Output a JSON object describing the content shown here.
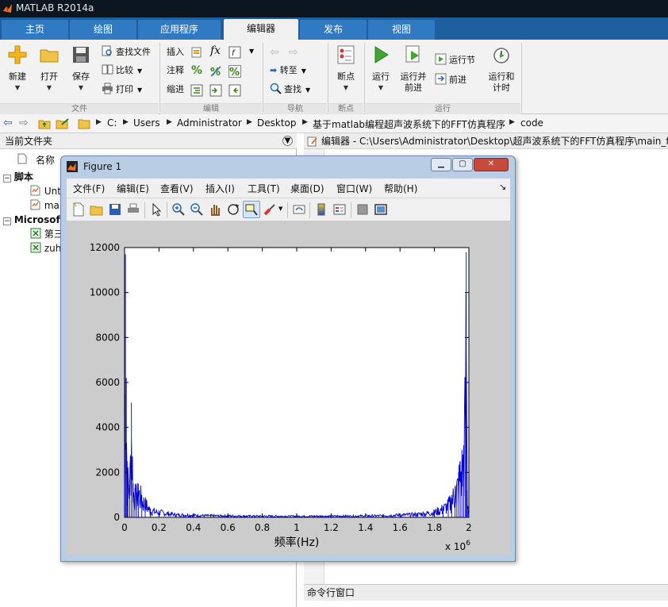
{
  "app": {
    "title": "MATLAB R2014a"
  },
  "tabs": [
    {
      "label": "主页",
      "active": false
    },
    {
      "label": "绘图",
      "active": false
    },
    {
      "label": "应用程序",
      "active": false
    },
    {
      "label": "编辑器",
      "active": true
    },
    {
      "label": "发布",
      "active": false
    },
    {
      "label": "视图",
      "active": false
    }
  ],
  "ribbon": {
    "file": {
      "new_label": "新建",
      "open_label": "打开",
      "save_label": "保存",
      "find_file_label": "查找文件",
      "compare_label": "比较",
      "print_label": "打印",
      "group_label": "文件"
    },
    "edit": {
      "insert_label": "插入",
      "fx_label": "fx",
      "comment_label": "注释",
      "comment_symbol": "%",
      "indent_label": "缩进",
      "group_label": "编辑"
    },
    "nav": {
      "goto_label": "转至",
      "find_label": "查找",
      "group_label": "导航"
    },
    "breakpoints": {
      "label": "断点",
      "group_label": "断点"
    },
    "run": {
      "run_label": "运行",
      "run_advance_label": "运行并\n前进",
      "run_section_label": "运行节",
      "advance_label": "前进",
      "run_time_label": "运行和\n计时",
      "group_label": "运行"
    }
  },
  "address": {
    "crumbs": [
      "C:",
      "Users",
      "Administrator",
      "Desktop",
      "基于matlab编程超声波系统下的FFT仿真程序",
      "code"
    ]
  },
  "current_folder": {
    "title": "当前文件夹",
    "column_name": "名称",
    "groups": [
      {
        "label": "脚本",
        "items": [
          "Unt",
          "ma"
        ]
      },
      {
        "label": "Microsoft",
        "items": [
          "第三",
          "zuh"
        ]
      }
    ]
  },
  "editor": {
    "title": "编辑器 - C:\\Users\\Administrator\\Desktop\\超声波系统下的FFT仿真程序\\main_f"
  },
  "command_window": {
    "title": "命令行窗口"
  },
  "figure": {
    "title": "Figure 1",
    "menus": [
      "文件(F)",
      "编辑(E)",
      "查看(V)",
      "插入(I)",
      "工具(T)",
      "桌面(D)",
      "窗口(W)",
      "帮助(H)"
    ],
    "menu_arrow": "↘",
    "toolbar_icons": [
      "new-figure-icon",
      "open-file-icon",
      "save-figure-icon",
      "print-figure-icon",
      "edit-plot-arrow-icon",
      "zoom-in-icon",
      "zoom-out-icon",
      "pan-hand-icon",
      "rotate-3d-icon",
      "data-cursor-icon",
      "brush-icon",
      "link-plot-icon",
      "colorbar-icon",
      "legend-icon",
      "hide-plot-tools-icon",
      "show-plot-tools-icon"
    ]
  },
  "chart_data": {
    "type": "line",
    "title": "",
    "xlabel": "频率(Hz)",
    "ylabel": "",
    "x_multiplier_label": "x 10",
    "x_multiplier_exponent": "6",
    "xlim": [
      0,
      2
    ],
    "ylim": [
      0,
      12000
    ],
    "xticks": [
      "0",
      "0.2",
      "0.4",
      "0.6",
      "0.8",
      "1",
      "1.2",
      "1.4",
      "1.6",
      "1.8",
      "2"
    ],
    "yticks": [
      "0",
      "2000",
      "4000",
      "6000",
      "8000",
      "10000",
      "12000"
    ],
    "grid": false,
    "series_color": "#0000c8",
    "x": [
      0.0,
      0.005,
      0.01,
      0.015,
      0.02,
      0.03,
      0.04,
      0.05,
      0.06,
      0.07,
      0.08,
      0.1,
      0.12,
      0.15,
      0.2,
      0.3,
      0.5,
      0.7,
      1.0,
      1.3,
      1.5,
      1.7,
      1.8,
      1.85,
      1.88,
      1.9,
      1.92,
      1.93,
      1.94,
      1.95,
      1.96,
      1.97,
      1.98,
      1.985,
      1.99,
      1.995,
      2.0
    ],
    "y": [
      1200,
      11700,
      6200,
      2500,
      2000,
      1700,
      5100,
      1500,
      1300,
      1100,
      1500,
      1000,
      800,
      400,
      300,
      150,
      100,
      80,
      70,
      80,
      100,
      180,
      300,
      500,
      700,
      1000,
      1400,
      1600,
      2000,
      2500,
      2800,
      3200,
      6200,
      11800,
      1200,
      500,
      300
    ]
  }
}
